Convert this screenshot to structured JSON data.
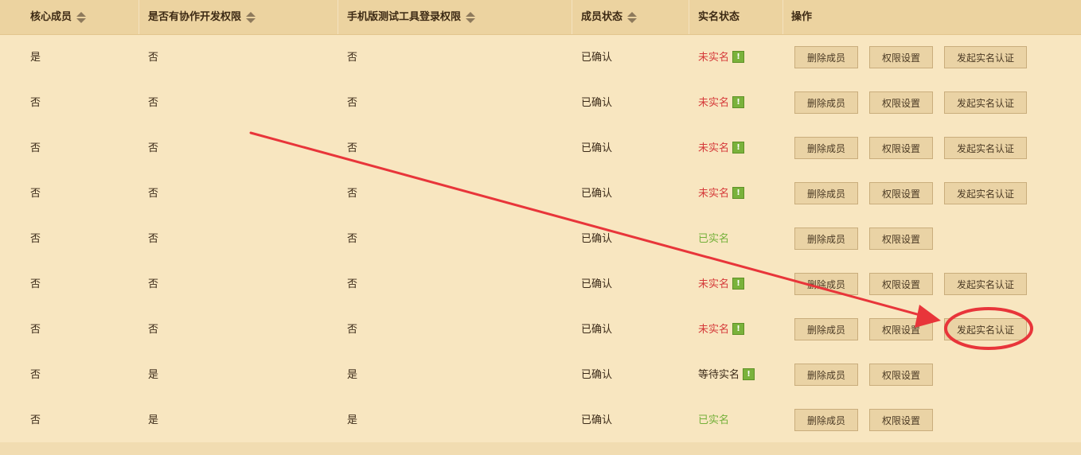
{
  "header": {
    "col1": "核心成员",
    "col2": "是否有协作开发权限",
    "col3": "手机版测试工具登录权限",
    "col4": "成员状态",
    "col5": "实名状态",
    "col6": "操作"
  },
  "buttons": {
    "delete": "删除成员",
    "perm": "权限设置",
    "verify": "发起实名认证"
  },
  "warn_glyph": "!",
  "rows": [
    {
      "core": "是",
      "collab": "否",
      "mobile": "否",
      "member": "已确认",
      "realname": "未实名",
      "state": "no"
    },
    {
      "core": "否",
      "collab": "否",
      "mobile": "否",
      "member": "已确认",
      "realname": "未实名",
      "state": "no"
    },
    {
      "core": "否",
      "collab": "否",
      "mobile": "否",
      "member": "已确认",
      "realname": "未实名",
      "state": "no"
    },
    {
      "core": "否",
      "collab": "否",
      "mobile": "否",
      "member": "已确认",
      "realname": "未实名",
      "state": "no"
    },
    {
      "core": "否",
      "collab": "否",
      "mobile": "否",
      "member": "已确认",
      "realname": "已实名",
      "state": "yes"
    },
    {
      "core": "否",
      "collab": "否",
      "mobile": "否",
      "member": "已确认",
      "realname": "未实名",
      "state": "no"
    },
    {
      "core": "否",
      "collab": "否",
      "mobile": "否",
      "member": "已确认",
      "realname": "未实名",
      "state": "no"
    },
    {
      "core": "否",
      "collab": "是",
      "mobile": "是",
      "member": "已确认",
      "realname": "等待实名",
      "state": "wait"
    },
    {
      "core": "否",
      "collab": "是",
      "mobile": "是",
      "member": "已确认",
      "realname": "已实名",
      "state": "yes"
    }
  ],
  "annotation": {
    "color": "#e8353a"
  }
}
